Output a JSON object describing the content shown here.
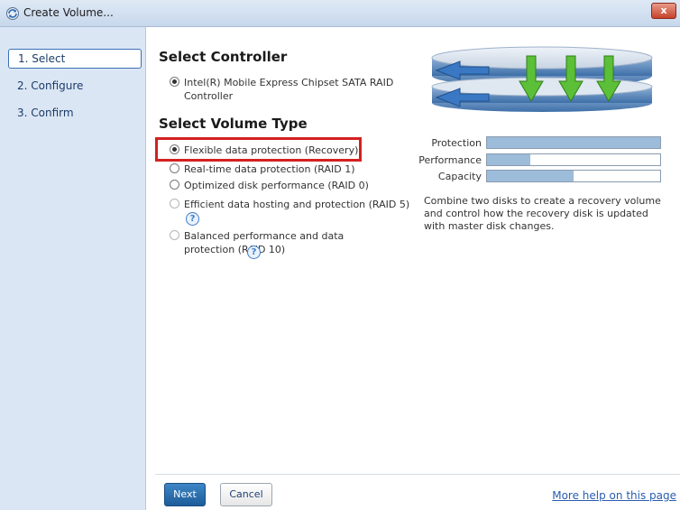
{
  "window": {
    "title": "Create Volume...",
    "close_label": "x"
  },
  "sidebar": {
    "steps": [
      {
        "label": "1. Select",
        "active": true
      },
      {
        "label": "2. Configure",
        "active": false
      },
      {
        "label": "3. Confirm",
        "active": false
      }
    ]
  },
  "controller": {
    "heading": "Select Controller",
    "option_label": "Intel(R) Mobile Express Chipset SATA RAID Controller",
    "selected": true
  },
  "volume_type": {
    "heading": "Select Volume Type",
    "options": [
      {
        "label": "Flexible data protection (Recovery)",
        "selected": true,
        "enabled": true
      },
      {
        "label": "Real-time data protection (RAID 1)",
        "selected": false,
        "enabled": true
      },
      {
        "label": "Optimized disk performance (RAID 0)",
        "selected": false,
        "enabled": true
      },
      {
        "label": "Efficient data hosting and protection (RAID 5)",
        "selected": false,
        "enabled": false
      },
      {
        "label": "Balanced performance and data protection (RAID 10)",
        "selected": false,
        "enabled": false
      }
    ]
  },
  "meters": [
    {
      "label": "Protection",
      "fraction": 1.0
    },
    {
      "label": "Performance",
      "fraction": 0.25
    },
    {
      "label": "Capacity",
      "fraction": 0.5
    }
  ],
  "description": "Combine two disks to create a recovery volume and control how the recovery disk is updated with master disk changes.",
  "buttons": {
    "next": "Next",
    "cancel": "Cancel"
  },
  "help_link": "More help on this page",
  "help_icon_glyph": "?",
  "colors": {
    "accent": "#1e5c99",
    "highlight": "#d42020",
    "meter_fill": "#9cbcd9",
    "sidebar_bg": "#dbe6f4",
    "arrow_green": "#4caf2a"
  }
}
